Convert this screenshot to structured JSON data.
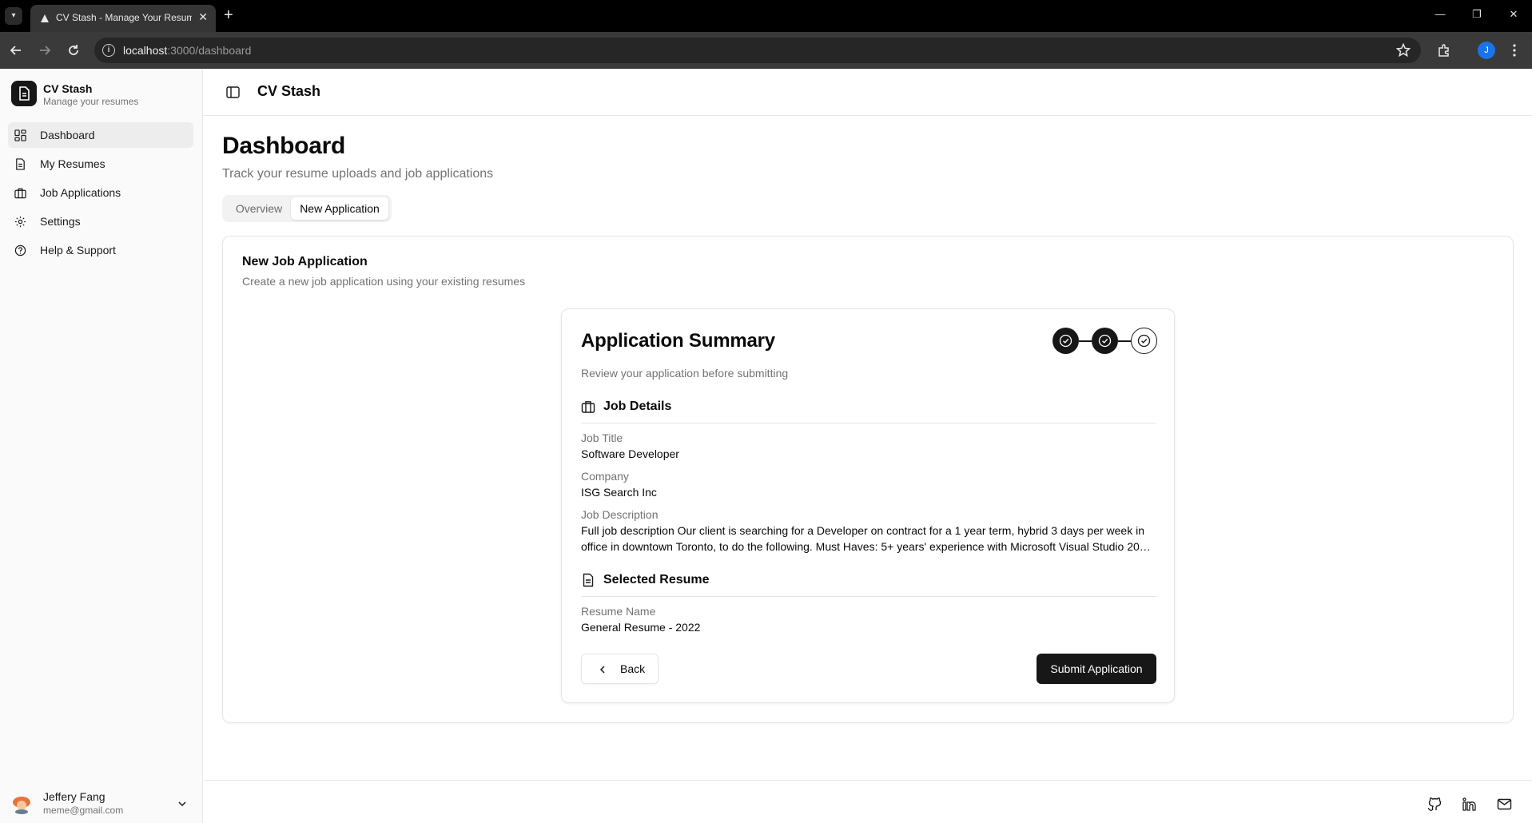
{
  "browser": {
    "tab_title": "CV Stash - Manage Your Resumes",
    "url_host": "localhost",
    "url_path": ":3000/dashboard",
    "profile_initial": "J"
  },
  "sidebar": {
    "brand_name": "CV Stash",
    "brand_sub": "Manage your resumes",
    "items": [
      {
        "label": "Dashboard",
        "icon": "dashboard-icon",
        "active": true
      },
      {
        "label": "My Resumes",
        "icon": "file-icon",
        "active": false
      },
      {
        "label": "Job Applications",
        "icon": "briefcase-icon",
        "active": false
      },
      {
        "label": "Settings",
        "icon": "gear-icon",
        "active": false
      },
      {
        "label": "Help & Support",
        "icon": "help-circle-icon",
        "active": false
      }
    ],
    "user": {
      "name": "Jeffery Fang",
      "email": "meme@gmail.com"
    }
  },
  "header": {
    "title": "CV Stash"
  },
  "page": {
    "title": "Dashboard",
    "subtitle": "Track your resume uploads and job applications",
    "tabs": [
      {
        "label": "Overview",
        "active": false
      },
      {
        "label": "New Application",
        "active": true
      }
    ]
  },
  "new_application": {
    "title": "New Job Application",
    "subtitle": "Create a new job application using your existing resumes"
  },
  "summary": {
    "title": "Application Summary",
    "subtitle": "Review your application before submitting",
    "steps_completed": 3,
    "job_section": "Job Details",
    "job_title_label": "Job Title",
    "job_title": "Software Developer",
    "company_label": "Company",
    "company": "ISG Search Inc",
    "description_label": "Job Description",
    "description": "Full job description Our client is searching for a Developer on contract for a 1 year term, hybrid 3 days per week in office in downtown Toronto, to do the following. Must Haves: 5+ years' experience with Microsoft Visual Studio 20…",
    "resume_section": "Selected Resume",
    "resume_name_label": "Resume Name",
    "resume_name": "General Resume - 2022",
    "back_label": "Back",
    "submit_label": "Submit Application"
  },
  "colors": {
    "primary": "#171717",
    "muted_text": "#737373",
    "border": "#e5e5e5"
  }
}
